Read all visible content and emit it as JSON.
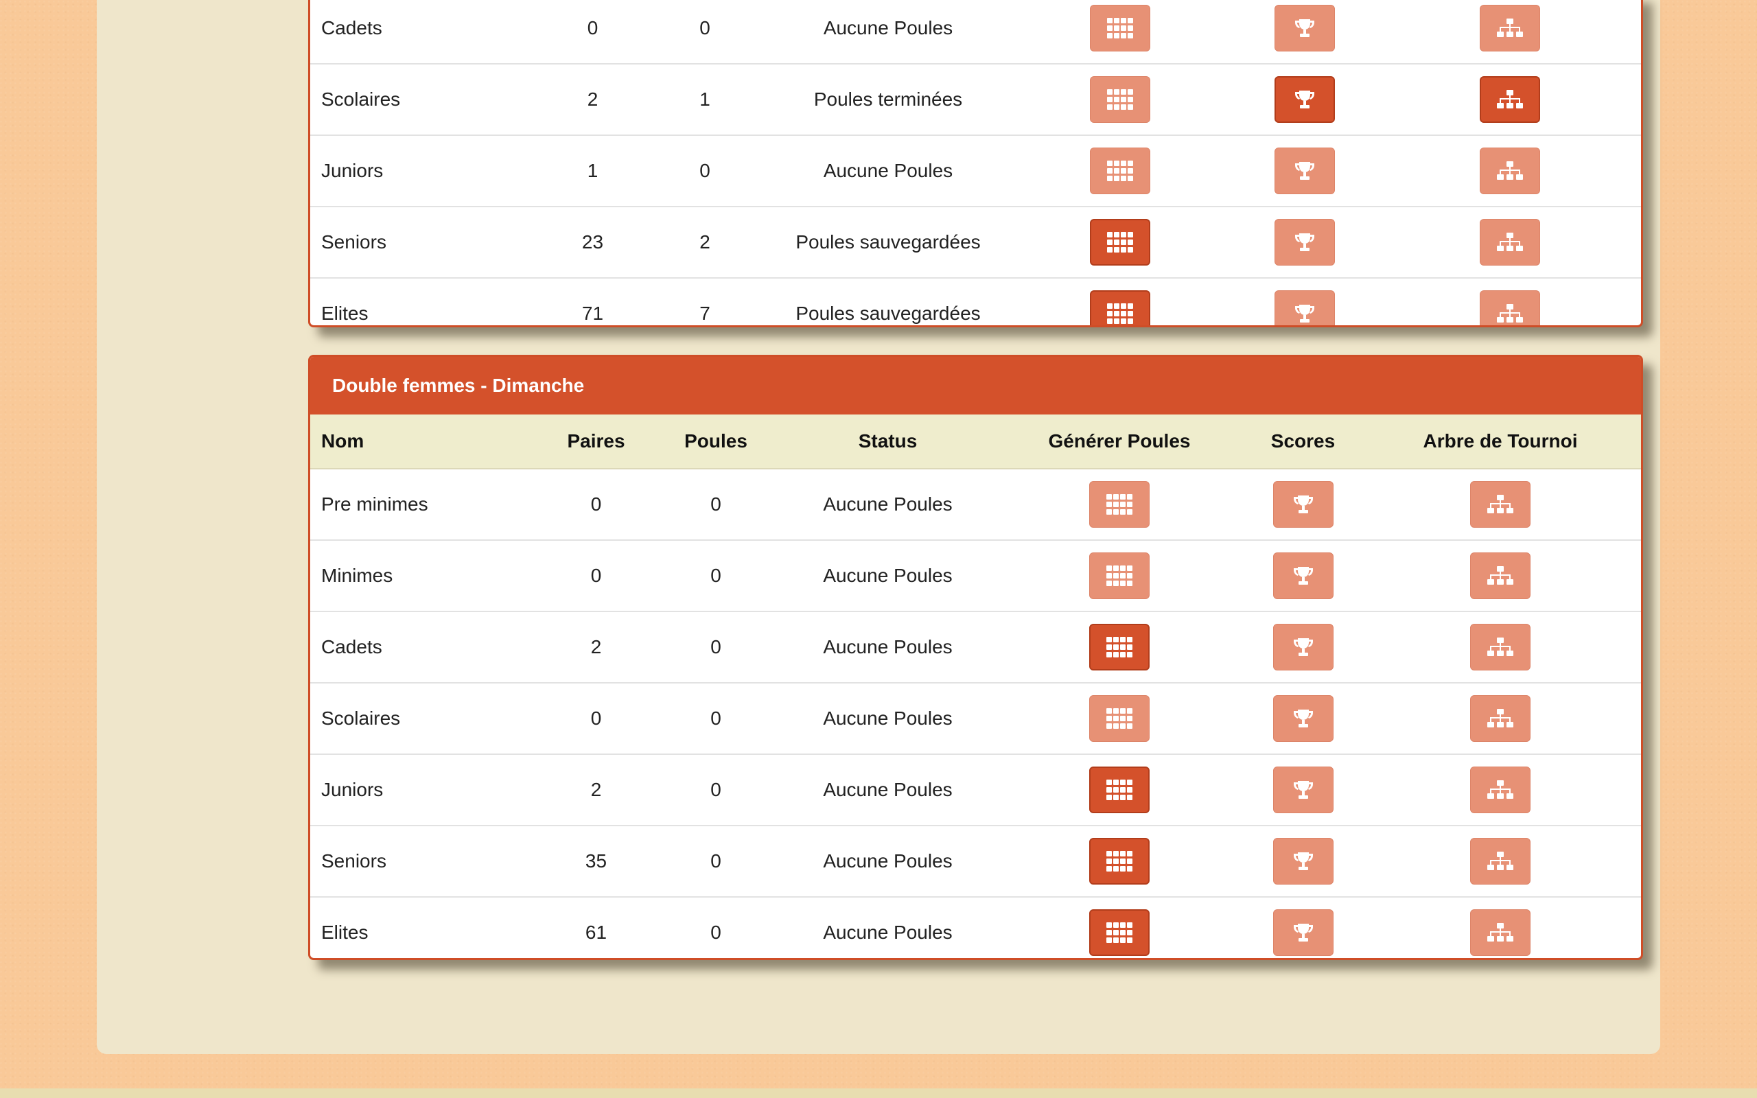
{
  "colors": {
    "page_background": "#f9c998",
    "content_background": "#efe6cb",
    "panel_heading": "#d4512b",
    "button_active": "#d4512b",
    "button_inactive": "#e79175",
    "header_row": "#efedcd"
  },
  "top_table": {
    "rows": [
      {
        "name": "Cadets",
        "paires": "0",
        "poules": "0",
        "status": "Aucune Poules",
        "poules_active": false,
        "scores_active": false,
        "arbre_active": false
      },
      {
        "name": "Scolaires",
        "paires": "2",
        "poules": "1",
        "status": "Poules terminées",
        "poules_active": false,
        "scores_active": true,
        "arbre_active": true
      },
      {
        "name": "Juniors",
        "paires": "1",
        "poules": "0",
        "status": "Aucune Poules",
        "poules_active": false,
        "scores_active": false,
        "arbre_active": false
      },
      {
        "name": "Seniors",
        "paires": "23",
        "poules": "2",
        "status": "Poules sauvegardées",
        "poules_active": true,
        "scores_active": false,
        "arbre_active": false
      },
      {
        "name": "Elites",
        "paires": "71",
        "poules": "7",
        "status": "Poules sauvegardées",
        "poules_active": true,
        "scores_active": false,
        "arbre_active": false
      }
    ]
  },
  "bottom_table": {
    "title": "Double femmes - Dimanche",
    "headers": {
      "nom": "Nom",
      "paires": "Paires",
      "poules": "Poules",
      "status": "Status",
      "generer": "Générer Poules",
      "scores": "Scores",
      "arbre": "Arbre de Tournoi"
    },
    "rows": [
      {
        "name": "Pre minimes",
        "paires": "0",
        "poules": "0",
        "status": "Aucune Poules",
        "poules_active": false,
        "scores_active": false,
        "arbre_active": false
      },
      {
        "name": "Minimes",
        "paires": "0",
        "poules": "0",
        "status": "Aucune Poules",
        "poules_active": false,
        "scores_active": false,
        "arbre_active": false
      },
      {
        "name": "Cadets",
        "paires": "2",
        "poules": "0",
        "status": "Aucune Poules",
        "poules_active": true,
        "scores_active": false,
        "arbre_active": false
      },
      {
        "name": "Scolaires",
        "paires": "0",
        "poules": "0",
        "status": "Aucune Poules",
        "poules_active": false,
        "scores_active": false,
        "arbre_active": false
      },
      {
        "name": "Juniors",
        "paires": "2",
        "poules": "0",
        "status": "Aucune Poules",
        "poules_active": true,
        "scores_active": false,
        "arbre_active": false
      },
      {
        "name": "Seniors",
        "paires": "35",
        "poules": "0",
        "status": "Aucune Poules",
        "poules_active": true,
        "scores_active": false,
        "arbre_active": false
      },
      {
        "name": "Elites",
        "paires": "61",
        "poules": "0",
        "status": "Aucune Poules",
        "poules_active": true,
        "scores_active": false,
        "arbre_active": false
      }
    ]
  },
  "icons": {
    "generer": "grid-icon",
    "scores": "trophy-icon",
    "arbre": "sitemap-icon"
  }
}
